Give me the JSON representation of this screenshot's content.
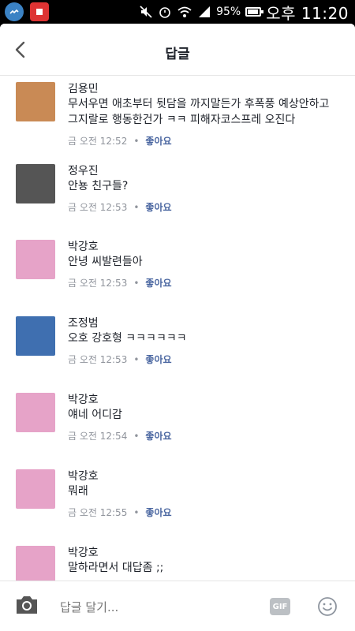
{
  "status": {
    "battery_pct": "95%",
    "time": "오후 11:20"
  },
  "header": {
    "title": "답글"
  },
  "comments": [
    {
      "name": "김용민",
      "lines": [
        "무서우면 애초부터 뒷담을 까지말든가 후폭풍 예상안하고",
        "그지랄로 행동한건가 ㅋㅋ 피해자코스프레 오진다"
      ],
      "time": "금 오전 12:52",
      "like": "좋아요",
      "avatar_color": "#c98a55"
    },
    {
      "name": "정우진",
      "lines": [
        "안뇽 친구들?"
      ],
      "time": "금 오전 12:53",
      "like": "좋아요",
      "avatar_color": "#555555"
    },
    {
      "name": "박강호",
      "lines": [
        "안녕 씨발련들아"
      ],
      "time": "금 오전 12:53",
      "like": "좋아요",
      "avatar_color": "#e6a3c8"
    },
    {
      "name": "조정범",
      "lines": [
        "오호 강호형 ㅋㅋㅋㅋㅋㅋ"
      ],
      "time": "금 오전 12:53",
      "like": "좋아요",
      "avatar_color": "#3f6fb0"
    },
    {
      "name": "박강호",
      "lines": [
        "얘네 어디감"
      ],
      "time": "금 오전 12:54",
      "like": "좋아요",
      "avatar_color": "#e6a3c8"
    },
    {
      "name": "박강호",
      "lines": [
        "뭐래"
      ],
      "time": "금 오전 12:55",
      "like": "좋아요",
      "avatar_color": "#e6a3c8"
    },
    {
      "name": "박강호",
      "lines": [
        "말하라면서 대답좀 ;;"
      ],
      "time": "",
      "like": "",
      "avatar_color": "#e6a3c8"
    }
  ],
  "footer": {
    "placeholder": "답글 달기...",
    "gif_label": "GIF"
  },
  "icons": {
    "back": "chevron-left-icon",
    "camera": "camera-icon",
    "emoji": "smiley-icon"
  }
}
